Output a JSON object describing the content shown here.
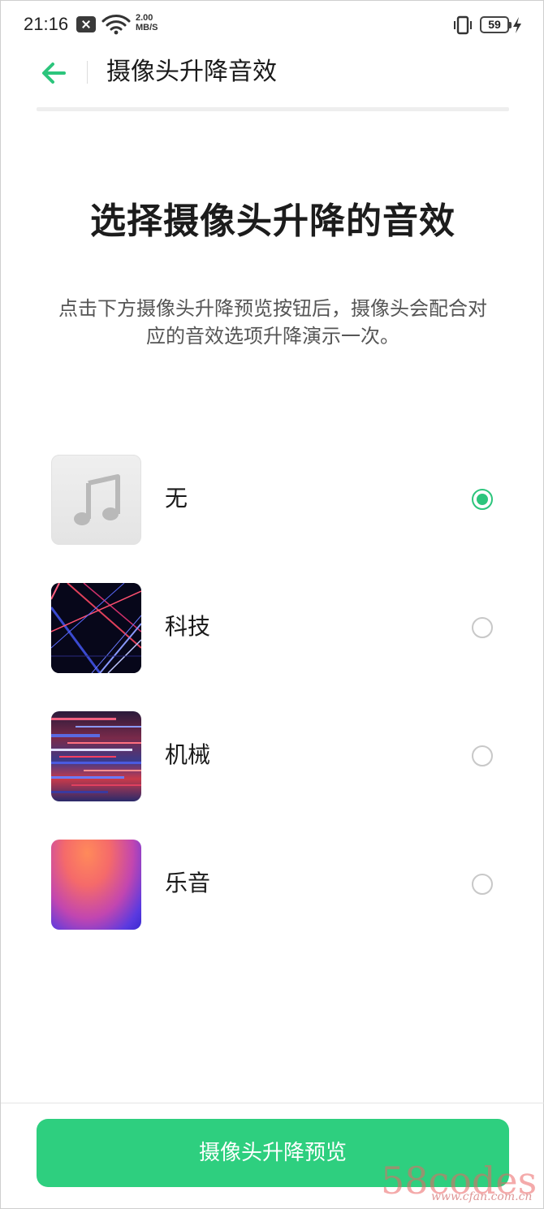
{
  "status_bar": {
    "time": "21:16",
    "net_speed_value": "2.00",
    "net_speed_unit": "MB/S",
    "battery_level": "59",
    "icons": [
      "notification-icon",
      "wifi-icon",
      "vibrate-icon",
      "battery-icon",
      "charging-icon"
    ]
  },
  "header": {
    "back_icon": "arrow-left-icon",
    "title": "摄像头升降音效"
  },
  "main": {
    "title": "选择摄像头升降的音效",
    "description": "点击下方摄像头升降预览按钮后，摄像头会配合对应的音效选项升降演示一次。",
    "options": [
      {
        "label": "无",
        "selected": true,
        "thumbnail": "music-note-icon"
      },
      {
        "label": "科技",
        "selected": false,
        "thumbnail": "tech-artwork"
      },
      {
        "label": "机械",
        "selected": false,
        "thumbnail": "mechanical-artwork"
      },
      {
        "label": "乐音",
        "selected": false,
        "thumbnail": "music-artwork"
      }
    ]
  },
  "footer": {
    "preview_button_label": "摄像头升降预览"
  },
  "watermark": {
    "text": "58codes",
    "sub": "www.cfan.com.cn"
  },
  "colors": {
    "accent": "#2ecf7f",
    "radio_checked": "#2cc57c",
    "radio_unchecked": "#c8c8c8"
  }
}
